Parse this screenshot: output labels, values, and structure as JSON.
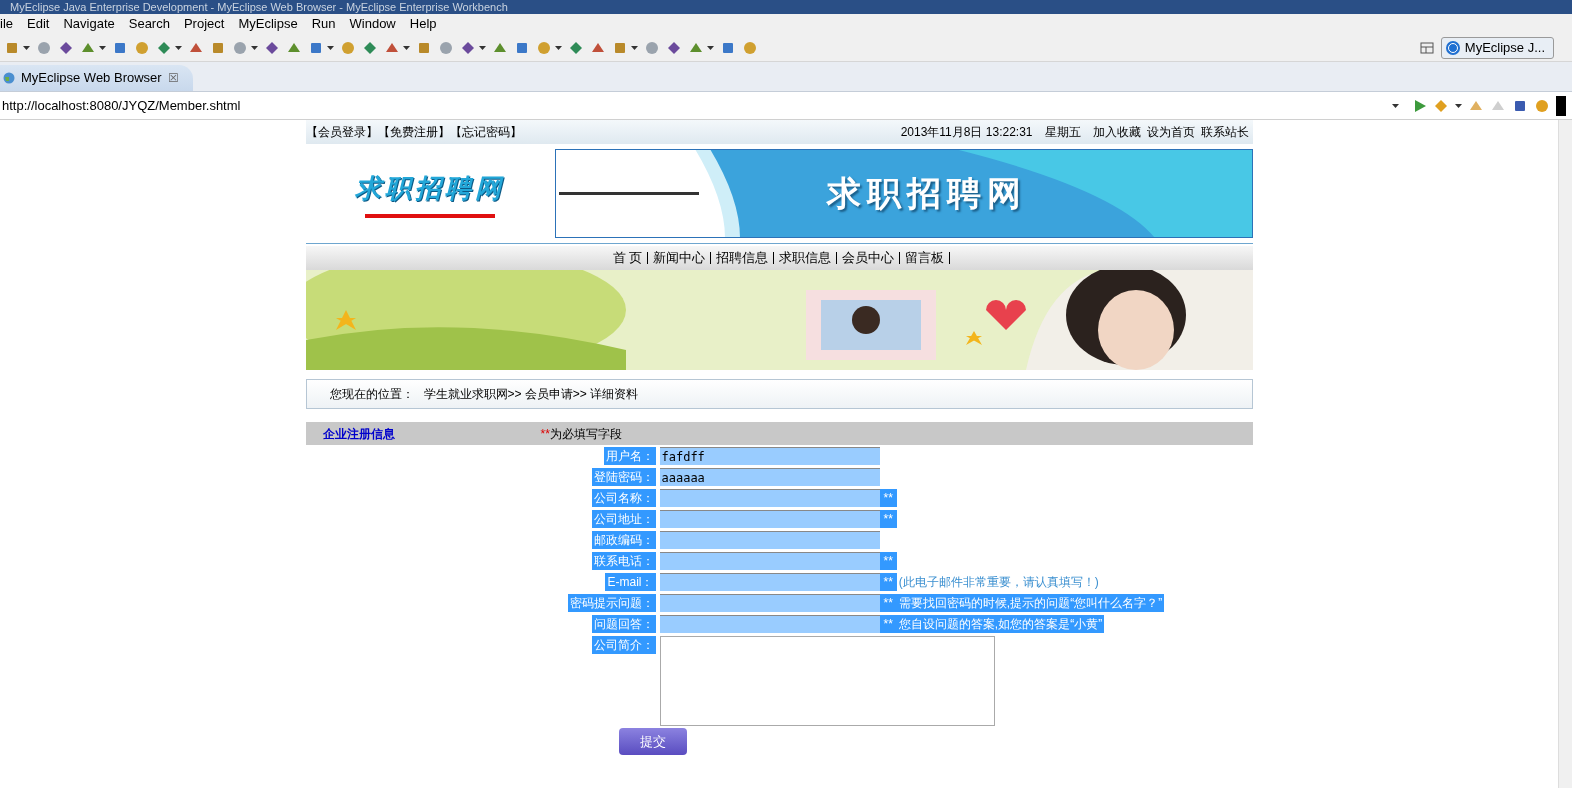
{
  "window": {
    "title": "MyEclipse Java Enterprise Development - MyEclipse Web Browser - MyEclipse Enterprise Workbench"
  },
  "menu": [
    "ile",
    "Edit",
    "Navigate",
    "Search",
    "Project",
    "MyEclipse",
    "Run",
    "Window",
    "Help"
  ],
  "perspective": {
    "label": "MyEclipse J..."
  },
  "editor_tab": {
    "label": "MyEclipse Web Browser",
    "close": "☒"
  },
  "address": {
    "value": "http://localhost:8080/JYQZ/Member.shtml"
  },
  "page": {
    "top_links": [
      "【会员登录】",
      "【免费注册】",
      "【忘记密码】"
    ],
    "datetime": "2013年11月8日 13:22:31",
    "weekday": "星期五",
    "top_right_links": [
      "加入收藏",
      "设为首页",
      "联系站长"
    ],
    "logo": "求职招聘网",
    "banner_title": "求职招聘网",
    "nav": [
      "首 页",
      "新闻中心",
      "招聘信息",
      "求职信息",
      "会员中心",
      "留言板"
    ],
    "breadcrumb_label": "您现在的位置：",
    "breadcrumb": "学生就业求职网>> 会员申请>> 详细资料",
    "section_title": "企业注册信息",
    "required_note_mark": "**",
    "required_note": "为必填写字段",
    "fields": [
      {
        "kind": "input",
        "label": "用户名：",
        "value": "fafdff"
      },
      {
        "kind": "input",
        "label": "登陆密码：",
        "value": "aaaaaa"
      },
      {
        "kind": "input",
        "label": "公司名称：",
        "mark": "**"
      },
      {
        "kind": "input",
        "label": "公司地址：",
        "mark": "**"
      },
      {
        "kind": "input",
        "label": "邮政编码："
      },
      {
        "kind": "input",
        "label": "联系电话：",
        "mark": "**"
      },
      {
        "kind": "input",
        "label": "E-mail：",
        "mark": "**",
        "hint": "(此电子邮件非常重要，请认真填写！)"
      },
      {
        "kind": "input",
        "label": "密码提示问题：",
        "mark": "**",
        "hint": "需要找回密码的时候,提示的问题“您叫什么名字？”"
      },
      {
        "kind": "input",
        "label": "问题回答：",
        "mark": "**",
        "hint": "您自设问题的答案,如您的答案是“小黄”"
      },
      {
        "kind": "textarea",
        "label": "公司简介："
      }
    ],
    "submit": "提交"
  }
}
